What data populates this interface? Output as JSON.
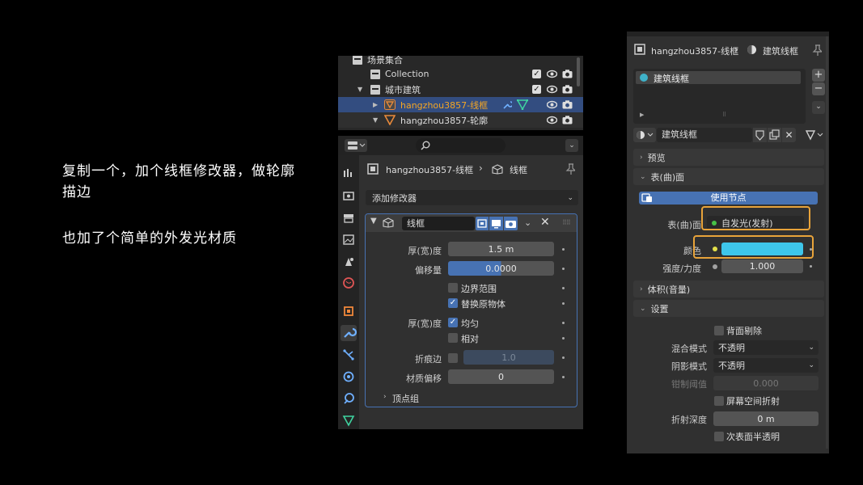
{
  "captions": {
    "line1": "复制一个，加个线框修改器，做轮廓描边",
    "line2": "也加了个简单的外发光材质"
  },
  "outliner": {
    "rows": [
      {
        "label": "场景集合"
      },
      {
        "label": "Collection"
      },
      {
        "label": "城市建筑"
      },
      {
        "label": "hangzhou3857-线框"
      },
      {
        "label": "hangzhou3857-轮廓"
      }
    ]
  },
  "modifier_panel": {
    "search_placeholder": "",
    "breadcrumb_object": "hangzhou3857-线框",
    "breadcrumb_modifier": "线框",
    "add_modifier_label": "添加修改器",
    "modifier_name": "线框",
    "thickness_label": "厚(宽)度",
    "thickness_value": "1.5 m",
    "offset_label": "偏移量",
    "offset_value": "0.0000",
    "boundary_label": "边界范围",
    "replace_original_label": "替换原物体",
    "thickness2_label": "厚(宽)度",
    "even_label": "均匀",
    "relative_label": "相对",
    "crease_label": "折痕边",
    "crease_value": "1.0",
    "material_offset_label": "材质偏移",
    "material_offset_value": "0",
    "vertex_group_label": "顶点组"
  },
  "material_panel": {
    "breadcrumb_object": "hangzhou3857-线框",
    "breadcrumb_material": "建筑线框",
    "slot_name": "建筑线框",
    "material_name": "建筑线框",
    "preview_label": "预览",
    "surface_section_label": "表(曲)面",
    "use_nodes_label": "使用节点",
    "surface_label": "表(曲)面",
    "surface_value": "自发光(发射)",
    "color_label": "颜色",
    "strength_label": "强度/力度",
    "strength_value": "1.000",
    "volume_label": "体积(音量)",
    "settings_label": "设置",
    "backface_label": "背面剔除",
    "blend_mode_label": "混合模式",
    "blend_mode_value": "不透明",
    "shadow_mode_label": "阴影模式",
    "shadow_mode_value": "不透明",
    "clip_label": "钳制阈值",
    "clip_value": "0.000",
    "ssr_label": "屏幕空间折射",
    "refraction_depth_label": "折射深度",
    "refraction_depth_value": "0 m",
    "subsurface_label": "次表面半透明"
  },
  "colors": {
    "accent_blue": "#4772b3",
    "emission_color": "#3ec6ea",
    "highlight_orange": "#e8a33a",
    "selected_text": "#f5a623"
  }
}
